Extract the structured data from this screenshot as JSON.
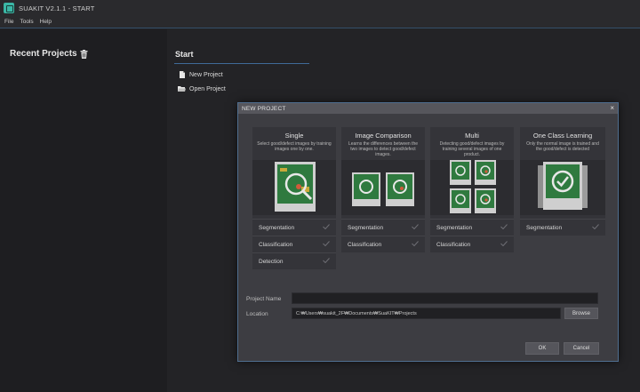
{
  "window": {
    "title": "SUAKIT V2.1.1 - START"
  },
  "menu": [
    "File",
    "Tools",
    "Help"
  ],
  "recent": {
    "title": "Recent Projects"
  },
  "start": {
    "title": "Start",
    "links": [
      {
        "label": "New Project",
        "icon": "new-file-icon"
      },
      {
        "label": "Open Project",
        "icon": "folder-open-icon"
      }
    ]
  },
  "dialog": {
    "title": "NEW PROJECT",
    "close_glyph": "×",
    "cards": [
      {
        "title": "Single",
        "desc": "Select good/defect images by training images one by one.",
        "rows": [
          "Segmentation",
          "Classification",
          "Detection"
        ]
      },
      {
        "title": "Image Comparison",
        "desc": "Learns the differences between the two images to detect good/defect images.",
        "rows": [
          "Segmentation",
          "Classification"
        ]
      },
      {
        "title": "Multi",
        "desc": "Detecting good/defect images by training several images of one product.",
        "rows": [
          "Segmentation",
          "Classification"
        ]
      },
      {
        "title": "One Class Learning",
        "desc": "Only the normal image is trained and the good/defect is detected",
        "rows": [
          "Segmentation"
        ]
      }
    ],
    "project_name": {
      "label": "Project Name",
      "value": ""
    },
    "location": {
      "label": "Location",
      "value": "C:₩Users₩suakit_2F₩Documents₩SuaKIT₩Projects"
    },
    "browse_label": "Browse",
    "ok_label": "OK",
    "cancel_label": "Cancel"
  },
  "colors": {
    "accent": "#3f6a98",
    "board_green": "#2f7a3f",
    "magnifier": "#e8e8e8",
    "defect": "#d25a3a"
  }
}
